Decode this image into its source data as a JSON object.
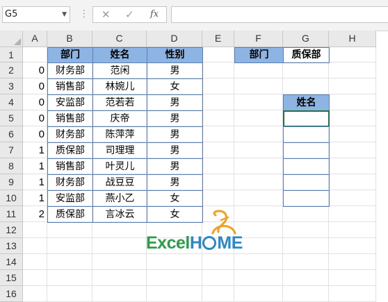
{
  "formula_bar": {
    "name_box": "G5",
    "formula": "",
    "icons": {
      "cancel": "close-icon",
      "enter": "check-icon",
      "insert_function": "fx-icon"
    },
    "fx_label": "fx"
  },
  "columns": [
    "A",
    "B",
    "C",
    "D",
    "E",
    "F",
    "G",
    "H"
  ],
  "rows": [
    "1",
    "2",
    "3",
    "4",
    "5",
    "6",
    "7",
    "8",
    "9",
    "10",
    "11",
    "12",
    "13",
    "14",
    "15",
    "16"
  ],
  "table": {
    "headers": [
      "部门",
      "姓名",
      "性别"
    ],
    "records": [
      {
        "a": "0",
        "dept": "财务部",
        "name": "范闲",
        "gender": "男"
      },
      {
        "a": "0",
        "dept": "销售部",
        "name": "林婉儿",
        "gender": "女"
      },
      {
        "a": "0",
        "dept": "安监部",
        "name": "范若若",
        "gender": "男"
      },
      {
        "a": "0",
        "dept": "销售部",
        "name": "庆帝",
        "gender": "男"
      },
      {
        "a": "0",
        "dept": "财务部",
        "name": "陈萍萍",
        "gender": "男"
      },
      {
        "a": "1",
        "dept": "质保部",
        "name": "司理理",
        "gender": "男"
      },
      {
        "a": "1",
        "dept": "销售部",
        "name": "叶灵儿",
        "gender": "男"
      },
      {
        "a": "1",
        "dept": "财务部",
        "name": "战豆豆",
        "gender": "男"
      },
      {
        "a": "1",
        "dept": "安监部",
        "name": "燕小乙",
        "gender": "女"
      },
      {
        "a": "2",
        "dept": "质保部",
        "name": "言冰云",
        "gender": "女"
      }
    ]
  },
  "criteria": {
    "dept_label": "部门",
    "dept_value": "质保部",
    "name_label": "姓名"
  },
  "logo": {
    "excel": "Excel",
    "home_h": "H",
    "home_rest": "ME"
  },
  "colors": {
    "header_fill": "#8db4e2",
    "border_blue": "#5b7fb5",
    "logo_green": "#2d9b4a",
    "logo_blue": "#2b88c8",
    "logo_orange": "#f0a020"
  }
}
